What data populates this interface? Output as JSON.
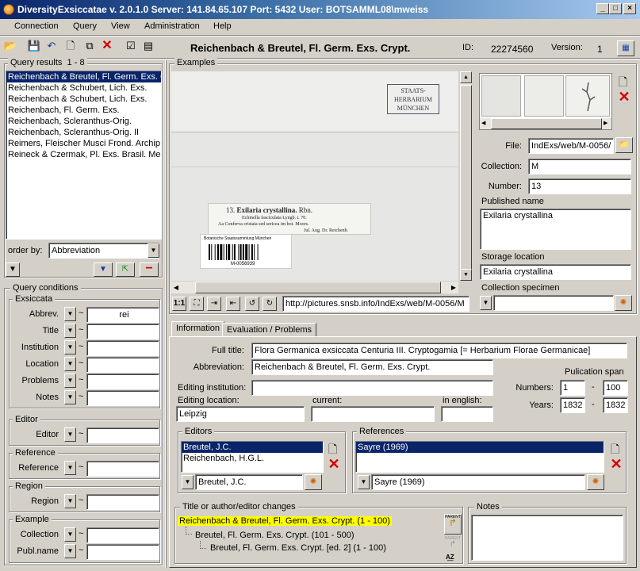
{
  "window": {
    "title": "DiversityExsiccatae    v. 2.0.1.0    Server: 141.84.65.107    Port: 5432    User: BOTSAMML08\\mweiss"
  },
  "menu": [
    "Connection",
    "Query",
    "View",
    "Administration",
    "Help"
  ],
  "header": {
    "record_title": "Reichenbach & Breutel, Fl. Germ. Exs. Crypt.",
    "id_label": "ID:",
    "id_value": "22274560",
    "version_label": "Version:",
    "version_value": "1"
  },
  "query_results": {
    "label": "Query results",
    "range": "1 - 8",
    "items": [
      "Reichenbach & Breutel, Fl. Germ. Exs. Crypt.",
      "Reichenbach & Schubert, Lich. Exs.",
      "Reichenbach & Schubert, Lich. Exs.",
      "Reichenbach, Fl. Germ. Exs.",
      "Reichenbach, Scleranthus-Orig.",
      "Reichenbach, Scleranthus-Orig. II",
      "Reimers, Fleischer Musci Frond. Archip. Indic.",
      "Reineck & Czermak, Pl. Exs. Brasil. Merid."
    ],
    "order_by_label": "order by:",
    "order_by_value": "Abbreviation"
  },
  "query_conditions": {
    "label": "Query conditions",
    "exsiccata": {
      "label": "Exsiccata",
      "fields": [
        {
          "label": "Abbrev.",
          "value": "rei"
        },
        {
          "label": "Title",
          "value": ""
        },
        {
          "label": "Institution",
          "value": ""
        },
        {
          "label": "Location",
          "value": ""
        },
        {
          "label": "Problems",
          "value": ""
        },
        {
          "label": "Notes",
          "value": ""
        }
      ]
    },
    "editor": {
      "label": "Editor",
      "field": "Editor"
    },
    "reference": {
      "label": "Reference",
      "field": "Reference"
    },
    "region": {
      "label": "Region",
      "field": "Region"
    },
    "example": {
      "label": "Example",
      "fields": [
        "Collection",
        "Publ.name"
      ]
    }
  },
  "examples": {
    "label": "Examples",
    "image": {
      "stamp_line1": "STAATS-",
      "stamp_line2": "HERBARIUM",
      "stamp_line3": "MÜNCHEN",
      "label_num": "13.",
      "label_name": "Exilaria crystallina.",
      "label_author": "Rbn.",
      "label_line2": "Echinella fasciculata Lyngb. t. 70.",
      "label_line3": "Aa Conferva cristata sed sericea im bot. Moors.",
      "label_line4": "Jul. Aug.    Dr. Reichenb.",
      "barcode_label": "Botanische Staatssammlung München",
      "barcode_text": "M-0056939"
    },
    "zoom_label": "1:1",
    "url": "http://pictures.snsb.info/IndExs/web/M-0056/M",
    "file_label": "File:",
    "file_value": "IndExs/web/M-0056/",
    "collection_label": "Collection:",
    "collection_value": "M",
    "number_label": "Number:",
    "number_value": "13",
    "published_name_label": "Published name",
    "published_name_value": "Exilaria crystallina",
    "storage_location_label": "Storage location",
    "storage_location_value": "Exilaria crystallina",
    "collection_specimen_label": "Collection specimen"
  },
  "tabs": [
    "Information",
    "Evaluation / Problems"
  ],
  "information": {
    "full_title_label": "Full title:",
    "full_title_value": "Flora Germanica exsiccata Centuria III. Cryptogamia [= Herbarium Florae Germanicae]",
    "abbreviation_label": "Abbreviation:",
    "abbreviation_value": "Reichenbach & Breutel, Fl. Germ. Exs. Crypt.",
    "publication_span_label": "Pulication span",
    "numbers_label": "Numbers:",
    "numbers_from": "1",
    "numbers_to": "100",
    "years_label": "Years:",
    "years_from": "1832",
    "years_to": "1832",
    "dash": "-",
    "editing_institution_label": "Editing institution:",
    "editing_location_label": "Editing location:",
    "editing_location_value": "Leipzig",
    "current_label": "current:",
    "in_english_label": "in english:"
  },
  "editors": {
    "label": "Editors",
    "items": [
      "Breutel, J.C.",
      "Reichenbach, H.G.L."
    ],
    "selected_value": "Breutel, J.C."
  },
  "references": {
    "label": "References",
    "items": [
      "Sayre (1969)"
    ],
    "selected_value": "Sayre (1969)"
  },
  "changes": {
    "label": "Title or author/editor changes",
    "items": [
      "Reichenbach & Breutel, Fl. Germ. Exs. Crypt. (1 - 100)",
      "Breutel, Fl. Germ. Exs. Crypt. (101 - 500)",
      "Breutel, Fl. Germ. Exs. Crypt. [ed. 2] (1 - 100)"
    ],
    "parent_label": "PARENT"
  },
  "notes": {
    "label": "Notes"
  },
  "colors": {
    "selection": "#0a246a",
    "highlight": "#ffff00",
    "delete": "#d40000"
  }
}
